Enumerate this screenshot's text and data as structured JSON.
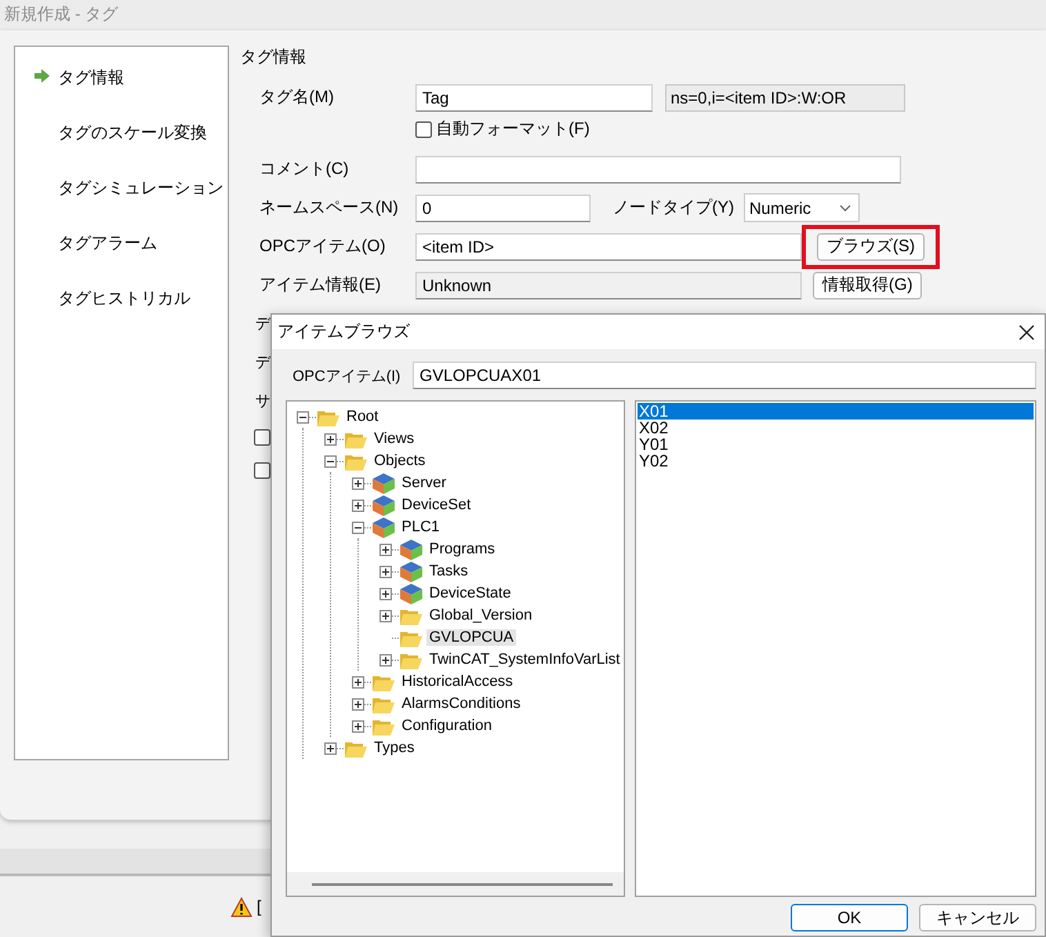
{
  "window": {
    "title": "新規作成 - タグ"
  },
  "sidebar": {
    "items": [
      {
        "label": "タグ情報",
        "selected": true
      },
      {
        "label": "タグのスケール変換",
        "selected": false
      },
      {
        "label": "タグシミュレーション",
        "selected": false
      },
      {
        "label": "タグアラーム",
        "selected": false
      },
      {
        "label": "タグヒストリカル",
        "selected": false
      }
    ]
  },
  "section_title": "タグ情報",
  "form": {
    "tag_name": {
      "label": "タグ名(M)",
      "value": "Tag"
    },
    "node_id": "ns=0,i=<item ID>:W:OR",
    "auto_format": {
      "label": "自動フォーマット(F)",
      "checked": false
    },
    "comment": {
      "label": "コメント(C)"
    },
    "namespace": {
      "label": "ネームスペース(N)",
      "value": "0"
    },
    "node_type": {
      "label": "ノードタイプ(Y)",
      "value": "Numeric"
    },
    "opc_item": {
      "label": "OPCアイテム(O)",
      "value": "<item ID>"
    },
    "browse_button": {
      "label": "ブラウズ(S)",
      "highlighted": true
    },
    "item_info": {
      "label": "アイテム情報(E)",
      "value": "Unknown"
    },
    "get_info_button": {
      "label": "情報取得(G)"
    },
    "covered_labels": [
      "デ",
      "デ",
      "サ"
    ],
    "covered_checkboxes": [
      {
        "checked": false
      },
      {
        "checked": false
      }
    ]
  },
  "status_bar": {
    "text": "["
  },
  "dialog": {
    "title": "アイテムブラウズ",
    "opc_item": {
      "label": "OPCアイテム(I)",
      "value": "GVLOPCUAX01"
    },
    "tree": [
      {
        "label": "Root",
        "kind": "folder",
        "expanded": true,
        "selected": false,
        "children": [
          {
            "label": "Views",
            "kind": "folder",
            "expanded": false,
            "selected": false
          },
          {
            "label": "Objects",
            "kind": "folder",
            "expanded": true,
            "selected": false,
            "children": [
              {
                "label": "Server",
                "kind": "object",
                "expanded": false,
                "selected": false
              },
              {
                "label": "DeviceSet",
                "kind": "object",
                "expanded": false,
                "selected": false
              },
              {
                "label": "PLC1",
                "kind": "object",
                "expanded": true,
                "selected": false,
                "children": [
                  {
                    "label": "Programs",
                    "kind": "object",
                    "expanded": false,
                    "selected": false
                  },
                  {
                    "label": "Tasks",
                    "kind": "object",
                    "expanded": false,
                    "selected": false
                  },
                  {
                    "label": "DeviceState",
                    "kind": "object",
                    "expanded": false,
                    "selected": false
                  },
                  {
                    "label": "Global_Version",
                    "kind": "folder",
                    "expanded": false,
                    "selected": false
                  },
                  {
                    "label": "GVLOPCUA",
                    "kind": "folder",
                    "leaf": true,
                    "selected": true
                  },
                  {
                    "label": "TwinCAT_SystemInfoVarList",
                    "kind": "folder",
                    "expanded": false,
                    "selected": false
                  }
                ]
              },
              {
                "label": "HistoricalAccess",
                "kind": "folder",
                "expanded": false,
                "selected": false
              },
              {
                "label": "AlarmsConditions",
                "kind": "folder",
                "expanded": false,
                "selected": false
              },
              {
                "label": "Configuration",
                "kind": "folder",
                "expanded": false,
                "selected": false
              }
            ]
          },
          {
            "label": "Types",
            "kind": "folder",
            "expanded": false,
            "selected": false
          }
        ]
      }
    ],
    "items": [
      {
        "label": "X01",
        "selected": true
      },
      {
        "label": "X02",
        "selected": false
      },
      {
        "label": "Y01",
        "selected": false
      },
      {
        "label": "Y02",
        "selected": false
      }
    ],
    "buttons": [
      {
        "label": "OK",
        "default": true
      },
      {
        "label": "キャンセル",
        "default": false
      }
    ]
  }
}
